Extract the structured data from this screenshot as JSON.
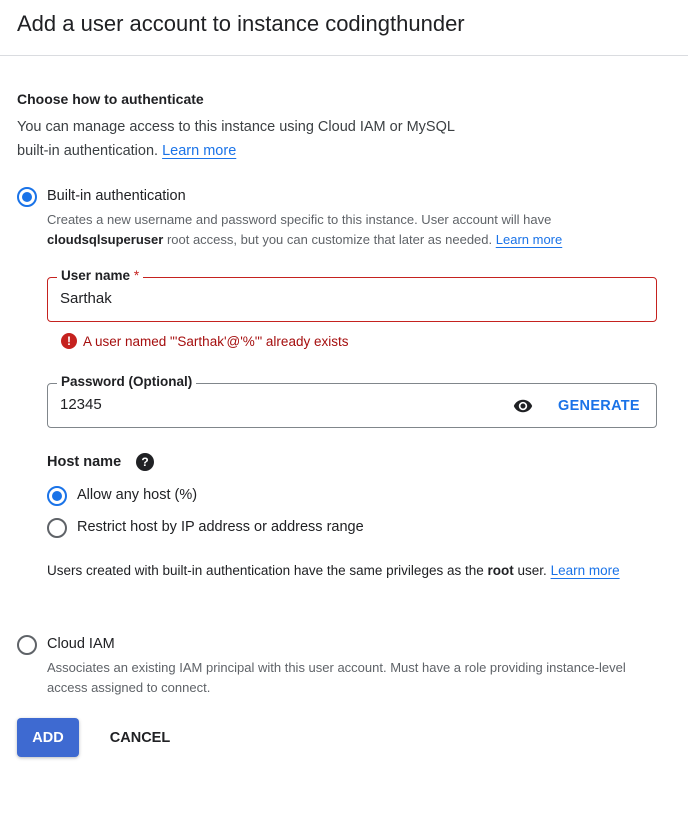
{
  "dialog": {
    "title": "Add a user account to instance codingthunder"
  },
  "auth_section": {
    "heading": "Choose how to authenticate",
    "intro_text": "You can manage access to this instance using Cloud IAM or MySQL built-in authentication.",
    "intro_link": "Learn more"
  },
  "builtin": {
    "label": "Built-in authentication",
    "selected": true,
    "desc_part1": "Creates a new username and password specific to this instance. User account will have",
    "desc_bold": "cloudsqlsuperuser",
    "desc_part2": "root access, but you can customize that later as needed.",
    "desc_link": "Learn more"
  },
  "username_field": {
    "label": "User name",
    "required_mark": "*",
    "value": "Sarthak",
    "error_icon": "error-icon",
    "error_text": "A user named \"'Sarthak'@'%'\" already exists"
  },
  "password_field": {
    "label": "Password (Optional)",
    "value": "12345",
    "visibility_icon": "eye-icon",
    "generate_label": "GENERATE"
  },
  "host": {
    "label": "Host name",
    "help_icon": "help-icon",
    "help_glyph": "?",
    "options": [
      {
        "label": "Allow any host (%)",
        "selected": true
      },
      {
        "label": "Restrict host by IP address or address range",
        "selected": false
      }
    ],
    "note_part1": "Users created with built-in authentication have the same privileges as the",
    "note_bold": "root",
    "note_part2": "user.",
    "note_link": "Learn more"
  },
  "cloud_iam": {
    "label": "Cloud IAM",
    "selected": false,
    "desc": "Associates an existing IAM principal with this user account. Must have a role providing instance-level access assigned to connect."
  },
  "actions": {
    "add_label": "ADD",
    "cancel_label": "CANCEL"
  },
  "colors": {
    "accent": "#1a73e8",
    "primary_button": "#3e6ad1",
    "error": "#c5221f"
  }
}
